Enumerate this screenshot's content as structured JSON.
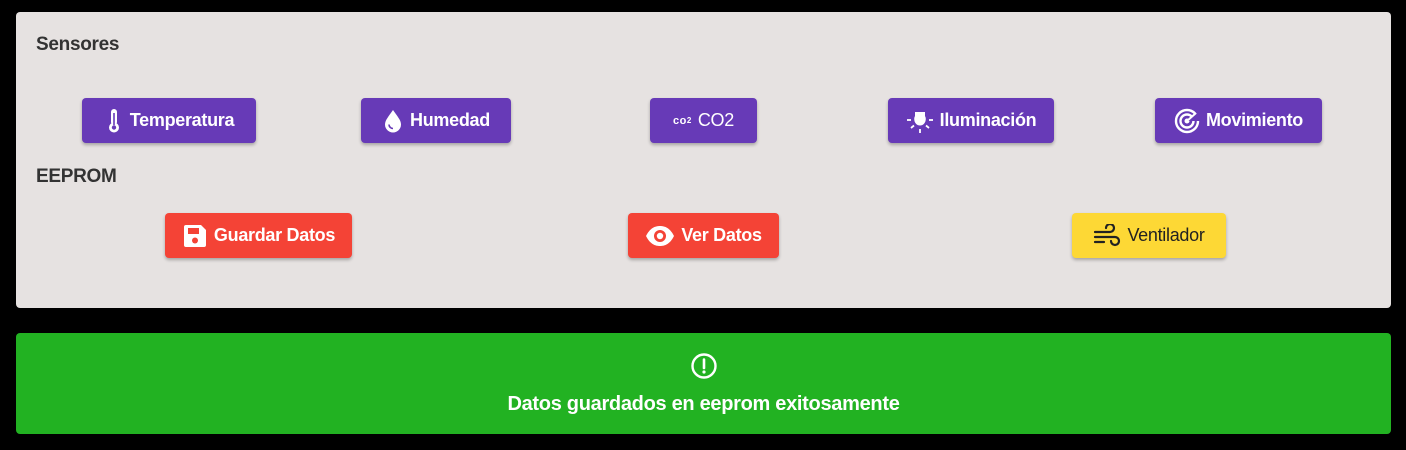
{
  "colors": {
    "panel_bg": "#e6e2e1",
    "sensor_button": "#673ab7",
    "eeprom_button": "#f44336",
    "fan_button": "#fdd835",
    "success_alert": "#22b222"
  },
  "sensores": {
    "title": "Sensores",
    "buttons": [
      {
        "label": "Temperatura",
        "icon": "thermometer-icon"
      },
      {
        "label": "Humedad",
        "icon": "water-drop-icon"
      },
      {
        "label": "CO2",
        "icon": "co2-icon",
        "icon_text": "co",
        "icon_sub": "2"
      },
      {
        "label": "Iluminación",
        "icon": "lightbulb-icon"
      },
      {
        "label": "Movimiento",
        "icon": "radar-icon"
      }
    ]
  },
  "eeprom": {
    "title": "EEPROM",
    "buttons": [
      {
        "label": "Guardar Datos",
        "icon": "floppy-disk-icon"
      },
      {
        "label": "Ver Datos",
        "icon": "eye-icon"
      },
      {
        "label": "Ventilador",
        "icon": "wind-icon"
      }
    ]
  },
  "alert": {
    "icon": "exclamation-circle-icon",
    "message": "Datos guardados en eeprom exitosamente"
  }
}
